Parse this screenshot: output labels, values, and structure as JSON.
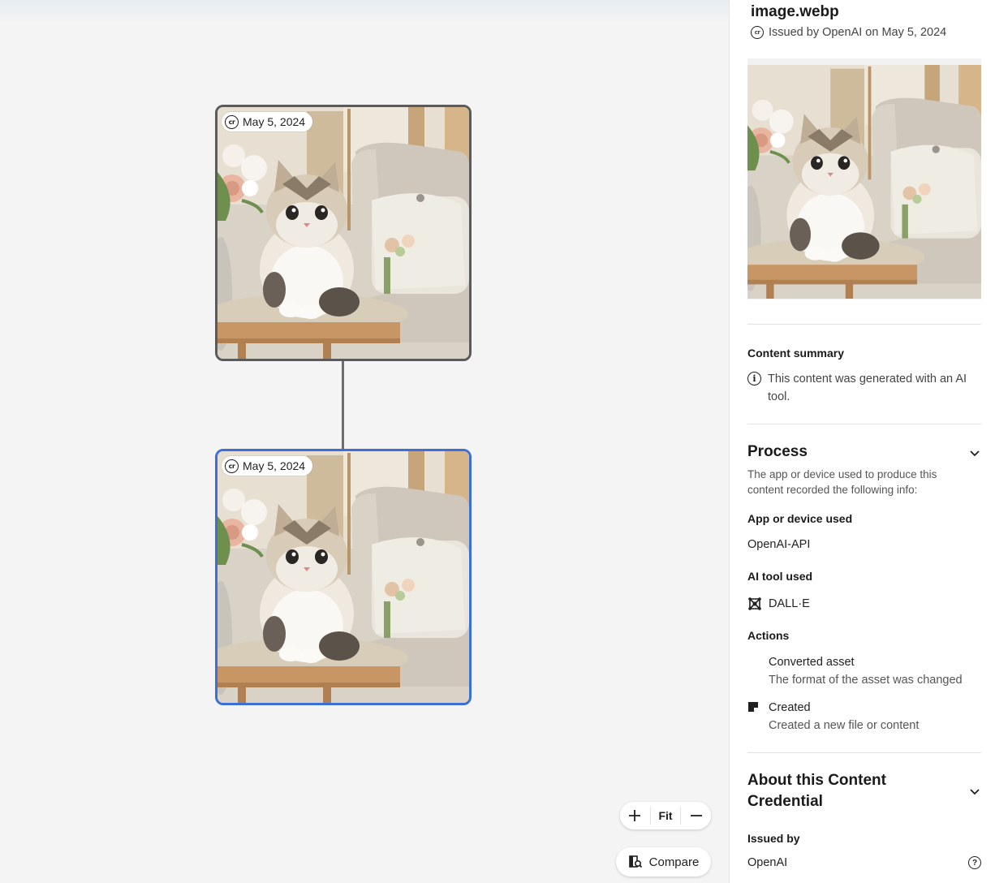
{
  "canvas": {
    "nodes": [
      {
        "date": "May 5, 2024",
        "selected": false
      },
      {
        "date": "May 5, 2024",
        "selected": true
      }
    ],
    "zoom": {
      "zoom_in": "+",
      "fit_label": "Fit",
      "zoom_out": "—"
    },
    "compare_label": "Compare"
  },
  "panel": {
    "file_name": "image.webp",
    "issued_line": "Issued by OpenAI on May 5, 2024",
    "content_summary": {
      "heading": "Content summary",
      "text": "This content was generated with an AI tool."
    },
    "process": {
      "heading": "Process",
      "description": "The app or device used to produce this content recorded the following info:",
      "app_heading": "App or device used",
      "app_value": "OpenAI-API",
      "ai_tool_heading": "AI tool used",
      "ai_tool_value": "DALL·E",
      "actions_heading": "Actions",
      "actions": [
        {
          "title": "Converted asset",
          "desc": "The format of the asset was changed",
          "icon": "convert-icon"
        },
        {
          "title": "Created",
          "desc": "Created a new file or content",
          "icon": "created-icon"
        }
      ]
    },
    "about": {
      "heading": "About this Content Credential",
      "issued_by_heading": "Issued by",
      "issued_by_value": "OpenAI"
    }
  },
  "colors": {
    "selected_border": "#3d6fd6",
    "node_border": "#5b5b5b",
    "connector": "#6d6d6d",
    "canvas_bg": "#f4f4f4"
  }
}
